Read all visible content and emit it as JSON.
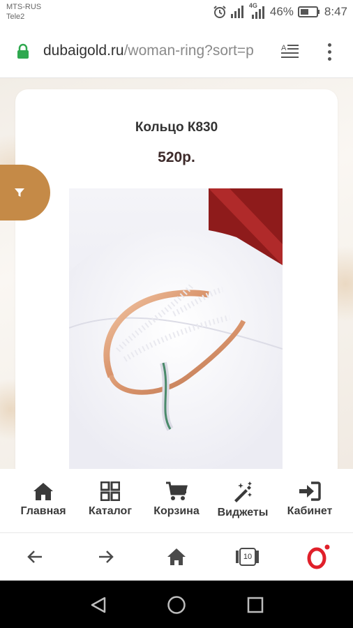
{
  "status_bar": {
    "carrier_1": "MTS-RUS",
    "carrier_2": "Tele2",
    "network": "4G",
    "battery": "46%",
    "time": "8:47"
  },
  "address_bar": {
    "domain": "dubaigold.ru",
    "path": "/woman-ring?sort=p"
  },
  "product": {
    "title": "Кольцо К830",
    "price": "520р."
  },
  "site_nav": [
    {
      "label": "Главная",
      "icon": "home-icon"
    },
    {
      "label": "Каталог",
      "icon": "grid-icon"
    },
    {
      "label": "Корзина",
      "icon": "cart-icon"
    },
    {
      "label": "Виджеты",
      "icon": "magic-wand-icon"
    },
    {
      "label": "Кабинет",
      "icon": "sign-in-icon"
    }
  ],
  "browser_toolbar": {
    "tab_count": "10"
  },
  "colors": {
    "accent": "#c58a47",
    "text_dark": "#333333",
    "opera_red": "#e0202a"
  }
}
